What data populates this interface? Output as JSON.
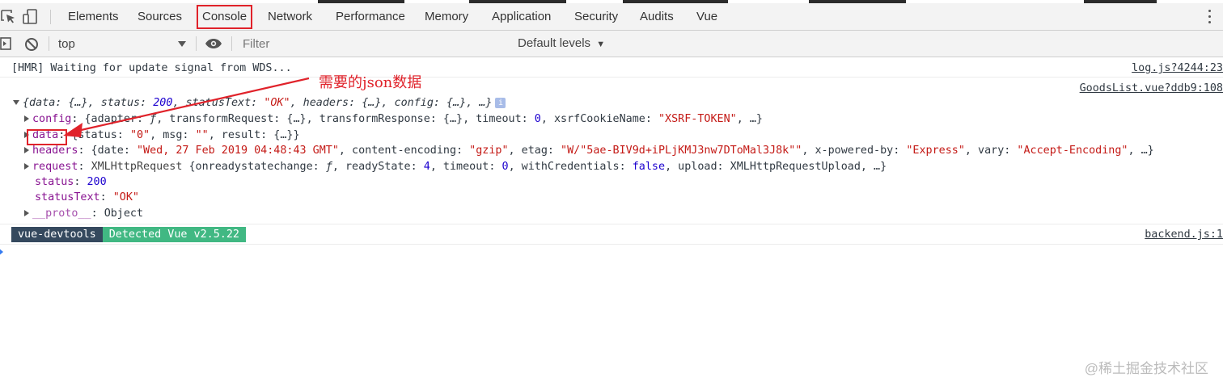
{
  "tabs": [
    {
      "label": "Elements"
    },
    {
      "label": "Sources"
    },
    {
      "label": "Console",
      "active": true
    },
    {
      "label": "Network"
    },
    {
      "label": "Performance"
    },
    {
      "label": "Memory"
    },
    {
      "label": "Application"
    },
    {
      "label": "Security"
    },
    {
      "label": "Audits"
    },
    {
      "label": "Vue"
    }
  ],
  "toolbar": {
    "context": "top",
    "filter_placeholder": "Filter",
    "levels": "Default levels"
  },
  "console": {
    "hmr_msg": "[HMR] Waiting for update signal from WDS...",
    "hmr_src": "log.js?4244:23",
    "goods_src": "GoodsList.vue?ddb9:108",
    "obj_summary": {
      "p1": "{data: {…}, status: ",
      "status": "200",
      "p2": ", statusText: ",
      "statusText": "\"OK\"",
      "p3": ", headers: {…}, config: {…}, …}"
    },
    "config": {
      "key": "config",
      "p1": ": {adapter: ",
      "fn": "ƒ",
      "p2": ", transformRequest: {…}, transformResponse: {…}, timeout: ",
      "timeout": "0",
      "p3": ", xsrfCookieName: ",
      "xsrf": "\"XSRF-TOKEN\"",
      "p4": ", …}"
    },
    "data": {
      "key": "data",
      "p1": ": {status: ",
      "status": "\"0\"",
      "p2": ", msg: ",
      "msg": "\"\"",
      "p3": ", result: {…}}"
    },
    "headers": {
      "key": "headers",
      "p1": ": {date: ",
      "date": "\"Wed, 27 Feb 2019 04:48:43 GMT\"",
      "p2": ", content-encoding: ",
      "enc": "\"gzip\"",
      "p3": ", etag: ",
      "etag": "\"W/\"5ae-BIV9d+iPLjKMJ3nw7DToMal3J8k\"\"",
      "p4": ", x-powered-by: ",
      "xpb": "\"Express\"",
      "p5": ", vary: ",
      "vary": "\"Accept-Encoding\"",
      "p6": ", …}"
    },
    "request": {
      "key": "request",
      "p1": ": ",
      "cls": "XMLHttpRequest",
      "p2": " {onreadystatechange: ",
      "fn": "ƒ",
      "p3": ", readyState: ",
      "rs": "4",
      "p4": ", timeout: ",
      "to": "0",
      "p5": ", withCredentials: ",
      "wc": "false",
      "p6": ", upload: XMLHttpRequestUpload, …}"
    },
    "status": {
      "key": "status",
      "sep": ": ",
      "val": "200"
    },
    "statusText": {
      "key": "statusText",
      "sep": ": ",
      "val": "\"OK\""
    },
    "proto": {
      "key": "__proto__",
      "sep": ": ",
      "val": "Object"
    },
    "vue_badge_1": "vue-devtools",
    "vue_badge_2": "Detected Vue v2.5.22",
    "vue_src": "backend.js:1"
  },
  "annotation": {
    "text": "需要的json数据",
    "color": "#e0222a"
  },
  "watermark": "@稀土掘金技术社区"
}
